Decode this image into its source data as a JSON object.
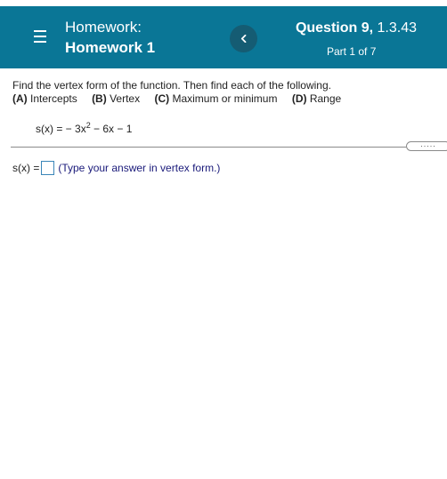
{
  "header": {
    "homework_label": "Homework:",
    "homework_name": "Homework 1",
    "question_label": "Question 9,",
    "question_section": "1.3.43",
    "part_progress": "Part 1 of 7",
    "background_color": "#0a7696"
  },
  "question": {
    "instructions": "Find the vertex form of the function. Then find each of the following.",
    "parts": [
      {
        "letter": "(A)",
        "label": "Intercepts"
      },
      {
        "letter": "(B)",
        "label": "Vertex"
      },
      {
        "letter": "(C)",
        "label": "Maximum or minimum"
      },
      {
        "letter": "(D)",
        "label": "Range"
      }
    ],
    "function_lhs": "s(x) = ",
    "function_coef": "− 3x",
    "function_exp": "2",
    "function_rest": " − 6x − 1"
  },
  "answer": {
    "label": "s(x) =",
    "value": "",
    "hint": "(Type your answer in vertex form.)"
  },
  "more_button": {
    "label": "....."
  },
  "icons": {
    "menu": "menu-icon",
    "back": "chevron-left-icon"
  }
}
